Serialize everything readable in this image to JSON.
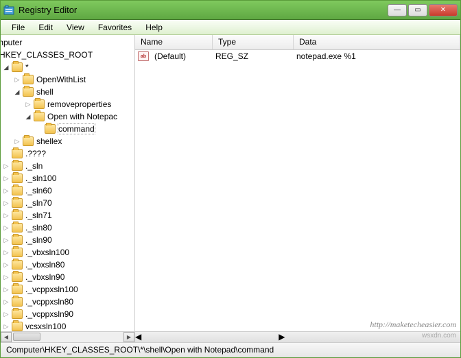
{
  "window": {
    "title": "Registry Editor"
  },
  "menu": [
    "File",
    "Edit",
    "View",
    "Favorites",
    "Help"
  ],
  "tree": {
    "root": "mputer",
    "hkey": "HKEY_CLASSES_ROOT",
    "star": "*",
    "openwithlist": "OpenWithList",
    "shell": "shell",
    "removeprops": "removeproperties",
    "openwithnotepad": "Open with Notepac",
    "command": "command",
    "shellex": "shellex",
    "dotq": ".????",
    "items": [
      "._sln",
      "._sln100",
      "._sln60",
      "._sln70",
      "._sln71",
      "._sln80",
      "._sln90",
      "._vbxsln100",
      "._vbxsln80",
      "._vbxsln90",
      "._vcppxsln100",
      "._vcppxsln80",
      "._vcppxsln90",
      "vcsxsln100"
    ]
  },
  "list": {
    "cols": {
      "name": "Name",
      "type": "Type",
      "data": "Data"
    },
    "rows": [
      {
        "name": "(Default)",
        "type": "REG_SZ",
        "data": "notepad.exe %1"
      }
    ]
  },
  "status": "Computer\\HKEY_CLASSES_ROOT\\*\\shell\\Open with Notepad\\command",
  "watermark": "http://maketecheasier.com",
  "watermark2": "wsxdn.com"
}
